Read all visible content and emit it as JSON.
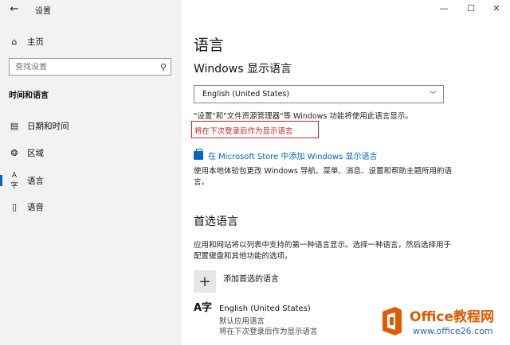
{
  "window": {
    "title": "设置",
    "back_icon": "←",
    "minimize_icon": "—",
    "maximize_icon": "☐",
    "close_icon": "✕"
  },
  "sidebar": {
    "home_label": "主页",
    "search_placeholder": "查找设置",
    "section_title": "时间和语言",
    "items": [
      {
        "label": "日期和时间",
        "icon": "calendar-clock-icon",
        "glyph": "▤"
      },
      {
        "label": "区域",
        "icon": "globe-icon",
        "glyph": "❂"
      },
      {
        "label": "语言",
        "icon": "language-icon",
        "glyph": "A字"
      },
      {
        "label": "语音",
        "icon": "microphone-icon",
        "glyph": "▯"
      }
    ]
  },
  "main": {
    "title": "语言",
    "display_language": {
      "heading": "Windows 显示语言",
      "selected": "English (United States)",
      "note": "\"设置\"和\"文件资源管理器\"等 Windows 功能将使用此语言显示。",
      "pending_note": "将在下次登录后作为显示语言",
      "store_link": "在 Microsoft Store 中添加 Windows 显示语言",
      "description": "使用本地体验包更改 Windows 导航、菜单、消息、设置和帮助主题所用的语言。"
    },
    "preferred": {
      "heading": "首选语言",
      "description": "应用和网站将以列表中支持的第一种语言显示。选择一种语言，然后选择用于配置键盘和其他功能的选项。",
      "add_label": "添加首选的语言",
      "languages": [
        {
          "name": "English (United States)",
          "sub1": "默认应用语言",
          "sub2": "将在下次登录后作为显示语言",
          "icon_glyph": "A字"
        }
      ]
    }
  },
  "watermark": {
    "brand": "Office教程网",
    "url": "www.office26.com"
  },
  "colors": {
    "accent": "#0067c0",
    "highlight_border": "#e02020",
    "sidebar_bg": "#f2f2f2",
    "watermark_orange": "#e05a00"
  }
}
